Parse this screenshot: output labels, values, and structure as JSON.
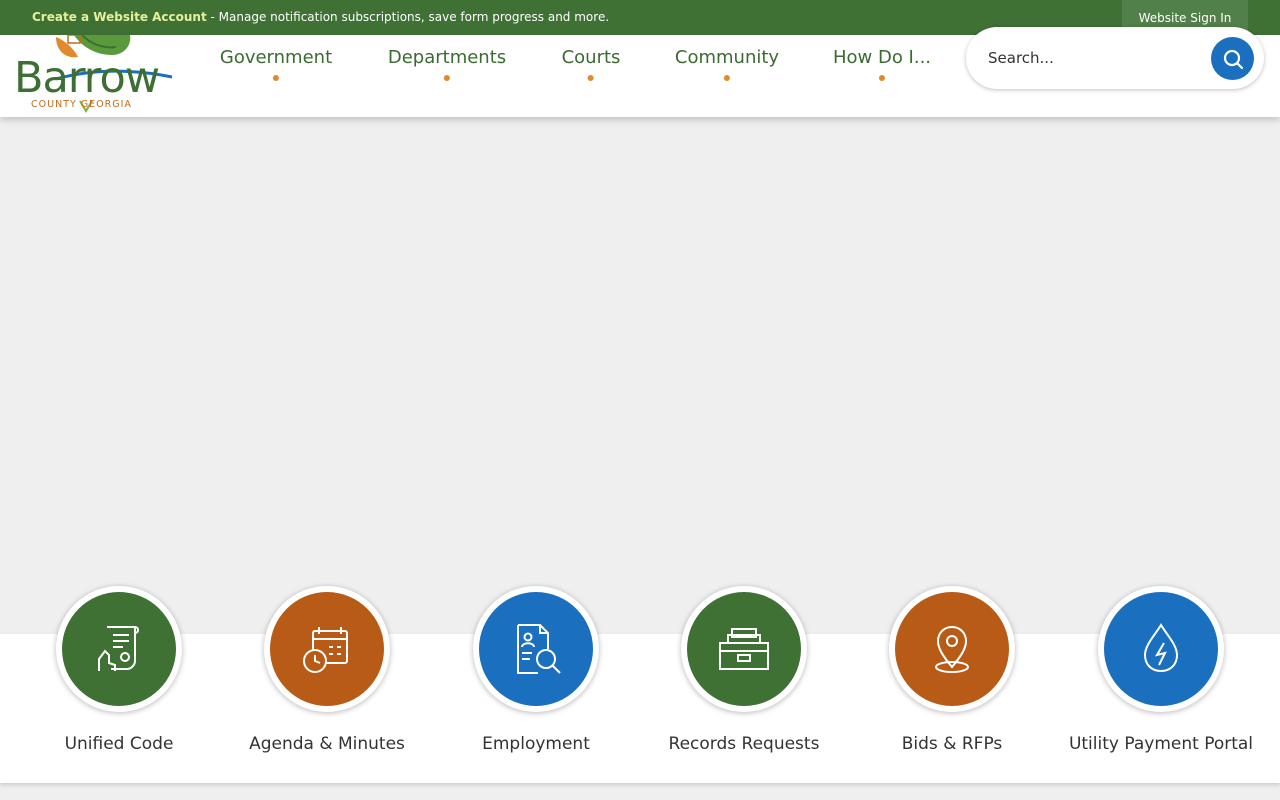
{
  "topbar": {
    "create_link": "Create a Website Account",
    "message": " - Manage notification subscriptions, save form progress and more.",
    "signin": "Website Sign In"
  },
  "logo": {
    "word": "Barrow",
    "sub": "COUNTY GEORGIA"
  },
  "nav": [
    {
      "label": "Government"
    },
    {
      "label": "Departments"
    },
    {
      "label": "Courts"
    },
    {
      "label": "Community"
    },
    {
      "label": "How Do I..."
    }
  ],
  "search": {
    "placeholder": "Search..."
  },
  "colors": {
    "green": "#3f7135",
    "orange": "#b85b17",
    "blue": "#1b6fbf",
    "accent_dot": "#e08a2a"
  },
  "quicklinks": [
    {
      "label": "Unified Code",
      "icon": "document-hand-gear-icon",
      "color": "#3f7135"
    },
    {
      "label": "Agenda & Minutes",
      "icon": "calendar-clock-icon",
      "color": "#b85b17"
    },
    {
      "label": "Employment",
      "icon": "document-search-icon",
      "color": "#1b6fbf"
    },
    {
      "label": "Records Requests",
      "icon": "file-cabinet-icon",
      "color": "#3f7135"
    },
    {
      "label": "Bids & RFPs",
      "icon": "map-pin-icon",
      "color": "#b85b17"
    },
    {
      "label": "Utility Payment Portal",
      "icon": "water-drop-bolt-icon",
      "color": "#1b6fbf"
    }
  ]
}
